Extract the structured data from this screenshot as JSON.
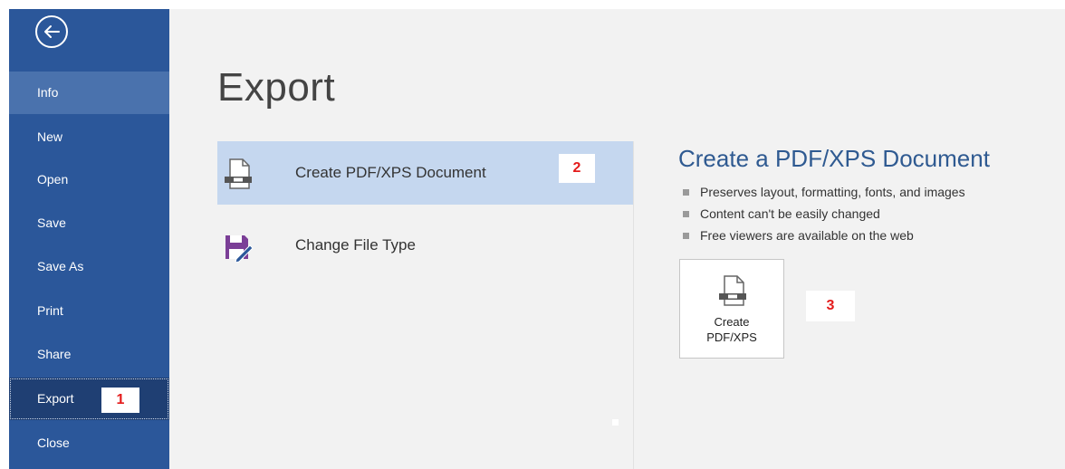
{
  "nav": {
    "items": [
      {
        "label": "Info"
      },
      {
        "label": "New"
      },
      {
        "label": "Open"
      },
      {
        "label": "Save"
      },
      {
        "label": "Save As"
      },
      {
        "label": "Print"
      },
      {
        "label": "Share"
      },
      {
        "label": "Export"
      },
      {
        "label": "Close"
      }
    ],
    "selected": "Export"
  },
  "main": {
    "title": "Export",
    "options": [
      {
        "label": "Create PDF/XPS Document",
        "selected": true
      },
      {
        "label": "Change File Type",
        "selected": false
      }
    ]
  },
  "details": {
    "title": "Create a PDF/XPS Document",
    "bullets": [
      "Preserves layout, formatting, fonts, and images",
      "Content can't be easily changed",
      "Free viewers are available on the web"
    ],
    "button_label": "Create\nPDF/XPS"
  },
  "annotations": {
    "step1": "1",
    "step2": "2",
    "step3": "3"
  },
  "icons": {
    "back": "back-arrow-icon",
    "pdf": "pdf-document-icon",
    "file_type": "save-edit-icon"
  },
  "colors": {
    "sidebar": "#2b579a",
    "sidebar_highlight": "#4a72ad",
    "sidebar_selected": "#1f3f73",
    "selected_option": "#c5d7ef",
    "accent_title": "#2f5a91",
    "annotation": "#e41b1b",
    "file_type_icon": "#7b3f97"
  }
}
